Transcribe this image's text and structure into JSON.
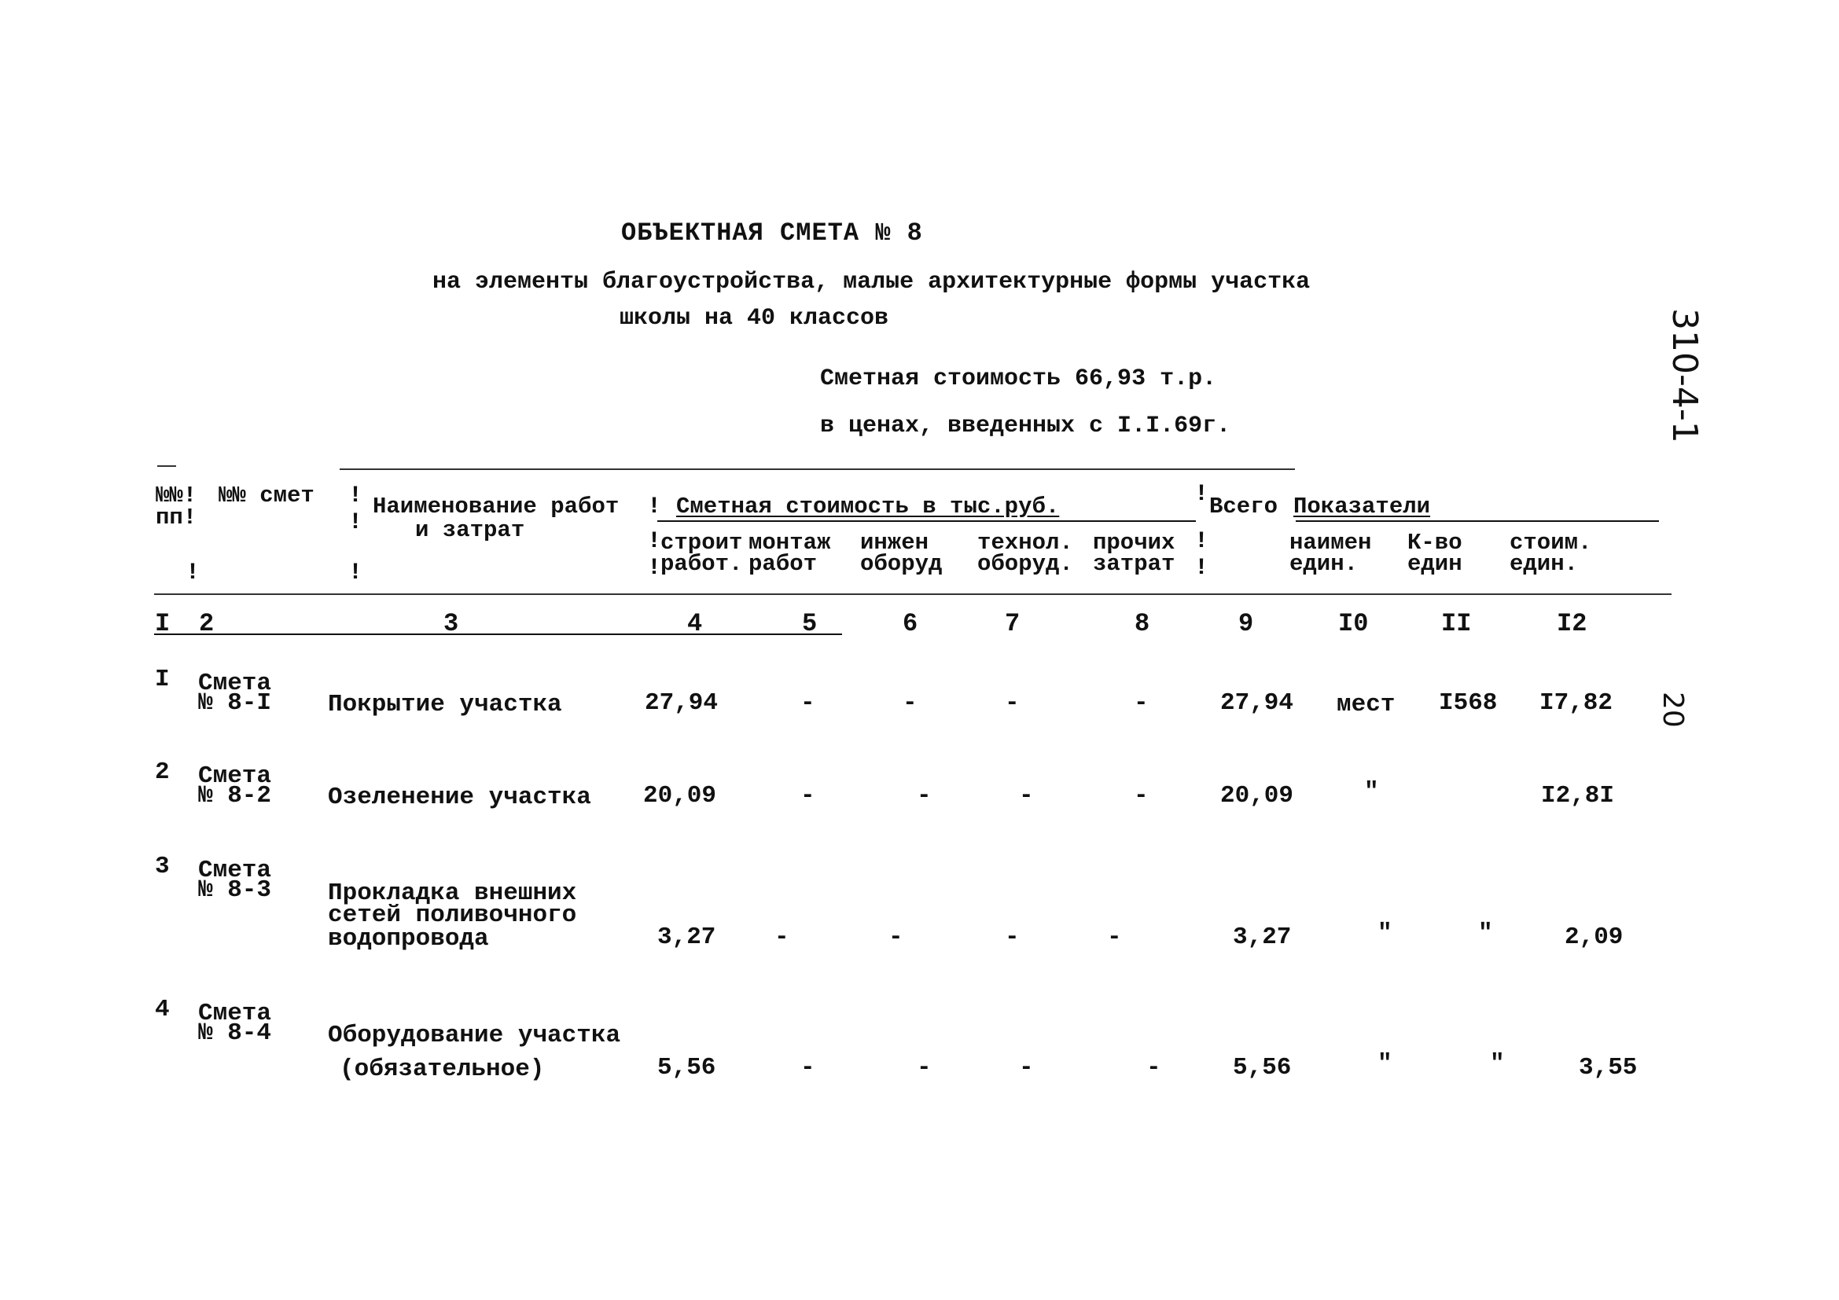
{
  "document": {
    "title": "ОБЪЕКТНАЯ СМЕТА № 8",
    "subtitle_line1": "на элементы благоустройства, малые архитектурные формы участка",
    "subtitle_line2": "школы на 40 классов",
    "cost_line": "Сметная стоимость 66,93 т.р.",
    "prices_line": "в ценах, введенных с I.I.69г.",
    "side_stamp": "310-4-1",
    "page_number": "20"
  },
  "table": {
    "headers": {
      "col_num": "№№! пп!",
      "col_num_l1": "№№!",
      "col_num_l2": "пп!",
      "col_estimate": "№№ смет",
      "col_name_l1": "Наименование работ",
      "col_name_l2": "и затрат",
      "cost_group": "Сметная стоимость в тыс.руб.",
      "construction_l1": "строит",
      "construction_l2": "работ.",
      "installation_l1": "монтаж",
      "installation_l2": "работ",
      "engineering_l1": "инжен",
      "engineering_l2": "оборуд",
      "technological_l1": "технол.",
      "technological_l2": "оборуд.",
      "other_l1": "прочих",
      "other_l2": "затрат",
      "total": "Всего",
      "indicators_group": "Показатели",
      "unit_name_l1": "наимен",
      "unit_name_l2": "един.",
      "unit_count_l1": "К-во",
      "unit_count_l2": "един",
      "unit_cost_l1": "стоим.",
      "unit_cost_l2": "един."
    },
    "column_numbers": [
      "I",
      "2",
      "3",
      "4",
      "5",
      "6",
      "7",
      "8",
      "9",
      "I0",
      "II",
      "I2"
    ],
    "rows": [
      {
        "num": "I",
        "estimate_l1": "Смета",
        "estimate_l2": "№ 8-I",
        "name_l1": "Покрытие участка",
        "name_l2": "",
        "name_l3": "",
        "construction": "27,94",
        "installation": "-",
        "engineering": "-",
        "technological": "-",
        "other": "-",
        "total": "27,94",
        "unit_name": "мест",
        "unit_count": "I568",
        "unit_cost": "I7,82"
      },
      {
        "num": "2",
        "estimate_l1": "Смета",
        "estimate_l2": "№ 8-2",
        "name_l1": "Озеленение участка",
        "name_l2": "",
        "name_l3": "",
        "construction": "20,09",
        "installation": "-",
        "engineering": "-",
        "technological": "-",
        "other": "-",
        "total": "20,09",
        "unit_name": "\"",
        "unit_count": "",
        "unit_cost": "I2,8I"
      },
      {
        "num": "3",
        "estimate_l1": "Смета",
        "estimate_l2": "№ 8-3",
        "name_l1": "Прокладка внешних",
        "name_l2": "сетей поливочного",
        "name_l3": "водопровода",
        "construction": "3,27",
        "installation": "-",
        "engineering": "-",
        "technological": "-",
        "other": "-",
        "total": "3,27",
        "unit_name": "\"",
        "unit_count": "\"",
        "unit_cost": "2,09"
      },
      {
        "num": "4",
        "estimate_l1": "Смета",
        "estimate_l2": "№ 8-4",
        "name_l1": "Оборудование участка",
        "name_l2": "(обязательное)",
        "name_l3": "",
        "construction": "5,56",
        "installation": "-",
        "engineering": "-",
        "technological": "-",
        "other": "-",
        "total": "5,56",
        "unit_name": "\"",
        "unit_count": "\"",
        "unit_cost": "3,55"
      }
    ]
  }
}
